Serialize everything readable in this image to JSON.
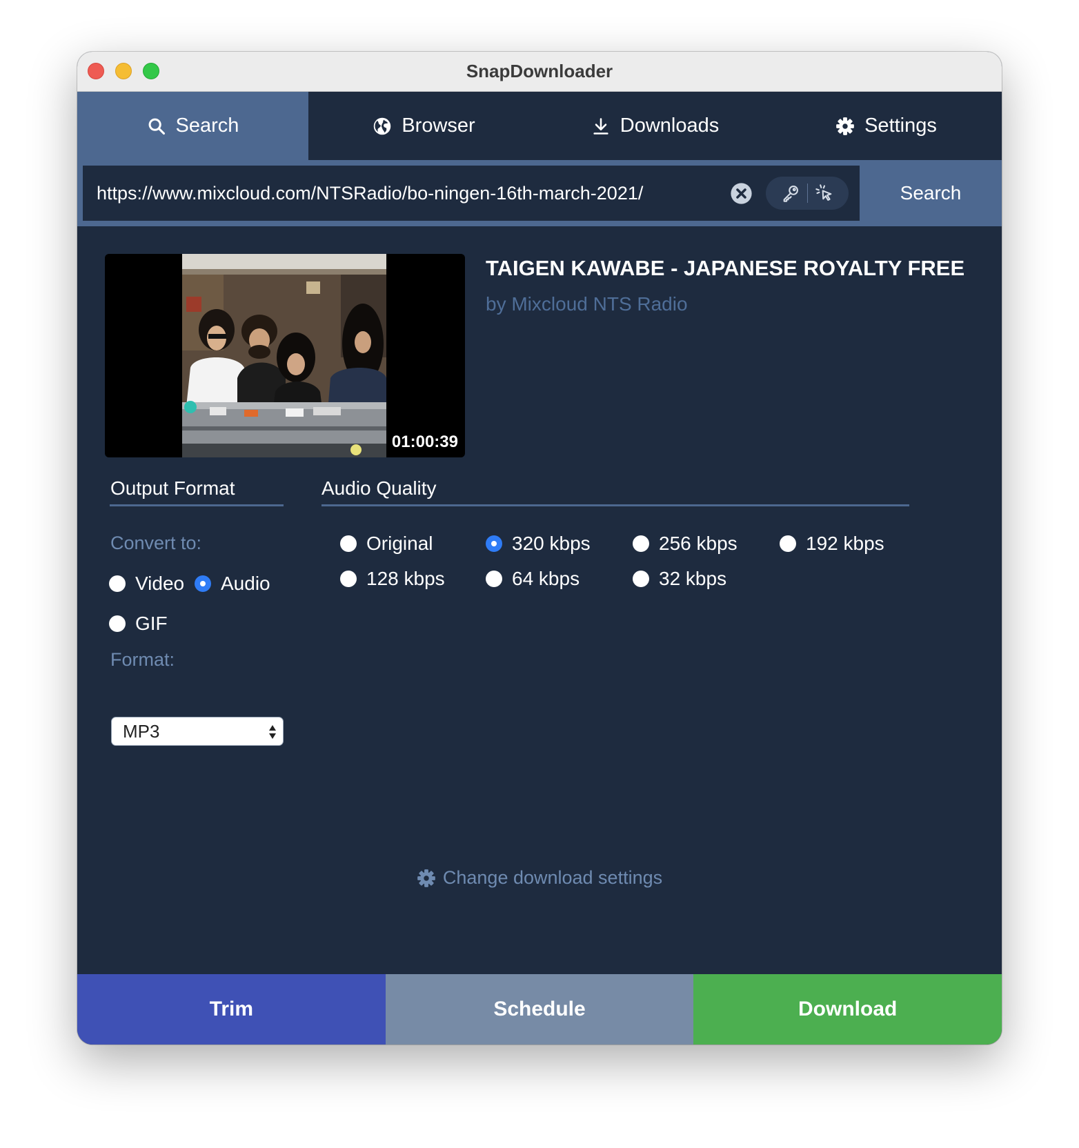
{
  "window": {
    "title": "SnapDownloader"
  },
  "tabs": [
    {
      "label": "Search",
      "icon": "search-icon",
      "active": true
    },
    {
      "label": "Browser",
      "icon": "globe-icon",
      "active": false
    },
    {
      "label": "Downloads",
      "icon": "download-icon",
      "active": false
    },
    {
      "label": "Settings",
      "icon": "gear-icon",
      "active": false
    }
  ],
  "search": {
    "url": "https://www.mixcloud.com/NTSRadio/bo-ningen-16th-march-2021/",
    "button_label": "Search"
  },
  "media": {
    "title": "TAIGEN KAWABE - JAPANESE ROYALTY FREE ...",
    "author": "by Mixcloud NTS Radio",
    "duration": "01:00:39"
  },
  "output_format": {
    "heading": "Output Format",
    "convert_label": "Convert to:",
    "options": [
      {
        "label": "Video",
        "selected": false
      },
      {
        "label": "Audio",
        "selected": true
      },
      {
        "label": "GIF",
        "selected": false
      }
    ],
    "format_label": "Format:",
    "format_value": "MP3"
  },
  "audio_quality": {
    "heading": "Audio Quality",
    "options": [
      {
        "label": "Original",
        "selected": false
      },
      {
        "label": "320 kbps",
        "selected": true
      },
      {
        "label": "256 kbps",
        "selected": false
      },
      {
        "label": "192 kbps",
        "selected": false
      },
      {
        "label": "128 kbps",
        "selected": false
      },
      {
        "label": "64 kbps",
        "selected": false
      },
      {
        "label": "32 kbps",
        "selected": false
      }
    ]
  },
  "links": {
    "change_settings": "Change download settings"
  },
  "actions": {
    "trim": "Trim",
    "schedule": "Schedule",
    "download": "Download"
  },
  "colors": {
    "window_bg": "#1e2b3f",
    "tab_active": "#4d6890",
    "accent_blue": "#2f7cf6",
    "trim": "#3f51b5",
    "schedule": "#778ba6",
    "download": "#4caf50"
  }
}
